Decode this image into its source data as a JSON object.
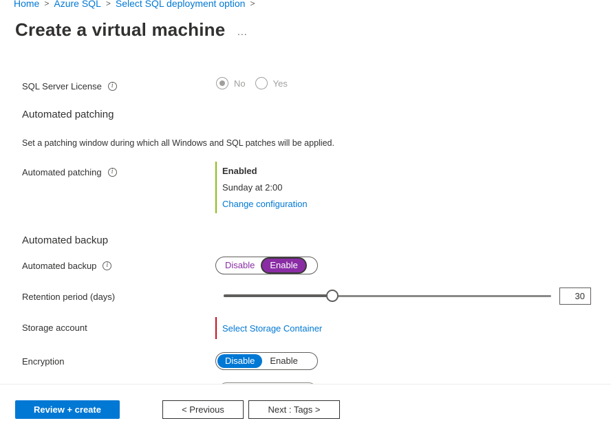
{
  "breadcrumb": {
    "items": [
      "Home",
      "Azure SQL",
      "Select SQL deployment option"
    ],
    "separator": ">"
  },
  "page": {
    "title": "Create a virtual machine",
    "more_label": "..."
  },
  "license": {
    "label": "SQL Server License",
    "options": [
      "No",
      "Yes"
    ],
    "selected": "No"
  },
  "patching": {
    "section_title": "Automated patching",
    "description": "Set a patching window during which all Windows and SQL patches will be applied.",
    "label": "Automated patching",
    "status": "Enabled",
    "schedule": "Sunday at 2:00",
    "change_link": "Change configuration",
    "accent_color": "#8cbd18"
  },
  "backup": {
    "section_title": "Automated backup",
    "label": "Automated backup",
    "disable_label": "Disable",
    "enable_label": "Enable",
    "selected": "Enable",
    "retention_label": "Retention period (days)",
    "retention_value": "30",
    "storage_label": "Storage account",
    "storage_link": "Select Storage Container",
    "storage_accent": "#c50f1f",
    "encryption_label": "Encryption",
    "encryption_disable": "Disable",
    "encryption_enable": "Enable",
    "encryption_selected": "Disable"
  },
  "footer": {
    "review_label": "Review + create",
    "previous_label": "< Previous",
    "next_label": "Next : Tags >"
  },
  "colors": {
    "primary": "#0078d4",
    "toggle_accent": "#8a2da5"
  }
}
